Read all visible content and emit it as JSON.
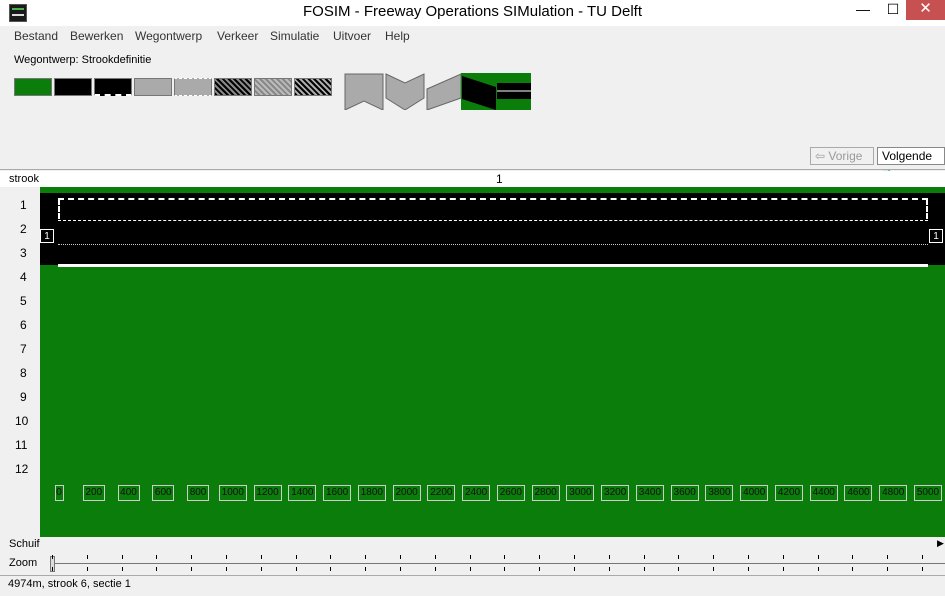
{
  "window": {
    "title": "FOSIM - Freeway Operations SIMulation - TU Delft",
    "min_glyph": "—",
    "max_glyph": "☐",
    "close_glyph": "✕"
  },
  "menu": [
    "Bestand",
    "Bewerken",
    "Wegontwerp",
    "Verkeer",
    "Simulatie",
    "Uitvoer",
    "Help"
  ],
  "toolbar": {
    "stage_label": "Wegontwerp: Strookdefinitie",
    "prev_label": "Vorige",
    "next_label": "Volgende"
  },
  "grid": {
    "strook_header": "strook",
    "section_number": "1",
    "lane_numbers": [
      "1",
      "2",
      "3",
      "4",
      "5",
      "6",
      "7",
      "8",
      "9",
      "10",
      "11",
      "12"
    ],
    "flow_in": "1",
    "flow_out": "1",
    "distance_labels": [
      "0",
      "200",
      "400",
      "600",
      "800",
      "1000",
      "1200",
      "1400",
      "1600",
      "1800",
      "2000",
      "2200",
      "2400",
      "2600",
      "2800",
      "3000",
      "3200",
      "3400",
      "3600",
      "3800",
      "4000",
      "4200",
      "4400",
      "4600",
      "4800",
      "5000"
    ]
  },
  "bottom": {
    "schuif_label": "Schuif",
    "zoom_label": "Zoom"
  },
  "status": "4974m, strook  6, sectie 1",
  "colors": {
    "grass": "#0a7d0a",
    "asphalt": "#000000",
    "close_button": "#c75050"
  }
}
